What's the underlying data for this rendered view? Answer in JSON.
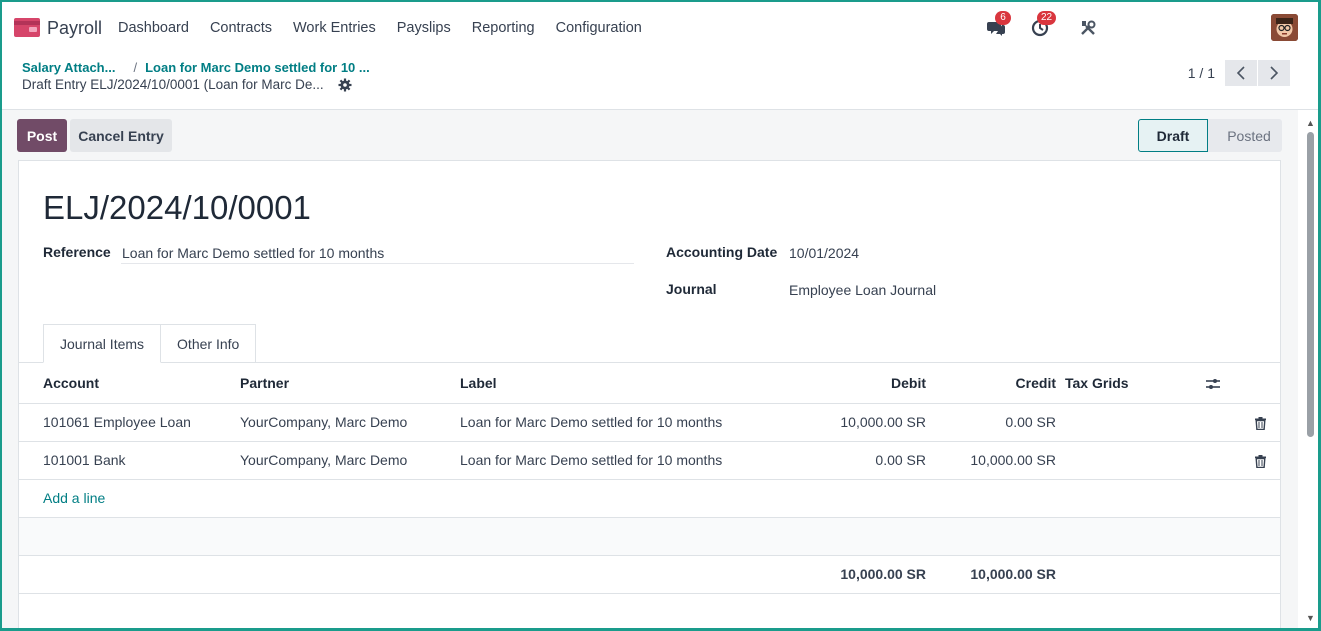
{
  "app": {
    "name": "Payroll",
    "menu": [
      "Dashboard",
      "Contracts",
      "Work Entries",
      "Payslips",
      "Reporting",
      "Configuration"
    ],
    "chat_badge": "6",
    "activity_badge": "22"
  },
  "breadcrumb": {
    "crumb1": "Salary Attach...",
    "crumb2": "Loan for Marc Demo settled for 10 ...",
    "current": "Draft Entry ELJ/2024/10/0001 (Loan for Marc De..."
  },
  "pager": {
    "text": "1 / 1"
  },
  "actions": {
    "post": "Post",
    "cancel": "Cancel Entry"
  },
  "status": {
    "draft": "Draft",
    "posted": "Posted"
  },
  "record": {
    "name": "ELJ/2024/10/0001",
    "reference_label": "Reference",
    "reference_value": "Loan for Marc Demo settled for 10 months",
    "date_label": "Accounting Date",
    "date_value": "10/01/2024",
    "journal_label": "Journal",
    "journal_value": "Employee Loan Journal"
  },
  "tabs": [
    "Journal Items",
    "Other Info"
  ],
  "table": {
    "headers": {
      "account": "Account",
      "partner": "Partner",
      "label": "Label",
      "debit": "Debit",
      "credit": "Credit",
      "tax": "Tax Grids"
    },
    "rows": [
      {
        "account": "101061 Employee Loan",
        "partner": "YourCompany, Marc Demo",
        "label": "Loan for Marc Demo settled for 10 months",
        "debit": "10,000.00 SR",
        "credit": "0.00 SR"
      },
      {
        "account": "101001 Bank",
        "partner": "YourCompany, Marc Demo",
        "label": "Loan for Marc Demo settled for 10 months",
        "debit": "0.00 SR",
        "credit": "10,000.00 SR"
      }
    ],
    "add_line": "Add a line",
    "total_debit": "10,000.00 SR",
    "total_credit": "10,000.00 SR"
  },
  "colors": {
    "primary": "#714b67",
    "link": "#017e84",
    "badge": "#d9363e"
  }
}
